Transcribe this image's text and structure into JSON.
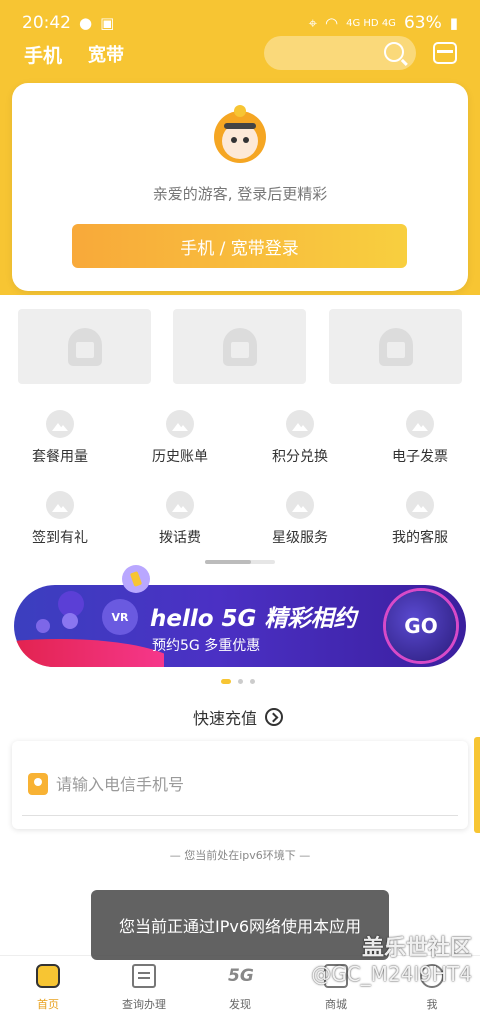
{
  "status_bar": {
    "time": "20:42",
    "battery": "63%",
    "network": "4G HD 4G"
  },
  "nav": {
    "tabs": [
      {
        "label": "手机"
      },
      {
        "label": "宽带"
      }
    ]
  },
  "login_card": {
    "guest_text": "亲爱的游客, 登录后更精彩",
    "login_button": "手机 / 宽带登录"
  },
  "services": [
    {
      "label": "套餐用量"
    },
    {
      "label": "历史账单"
    },
    {
      "label": "积分兑换"
    },
    {
      "label": "电子发票"
    },
    {
      "label": "签到有礼"
    },
    {
      "label": "拨话费"
    },
    {
      "label": "星级服务"
    },
    {
      "label": "我的客服"
    }
  ],
  "promo": {
    "title": "hello 5G 精彩相约",
    "subtitle": "预约5G 多重优惠",
    "badge": "VR",
    "go_label": "GO"
  },
  "carousel": {
    "active_index": 0,
    "count": 3
  },
  "recharge": {
    "title": "快速充值",
    "placeholder": "请输入电信手机号"
  },
  "ipv6_note": "— 您当前处在ipv6环境下 —",
  "toast": "您当前正通过IPv6网络使用本应用",
  "tab_bar": {
    "items": [
      {
        "label": "首页"
      },
      {
        "label": "查询办理"
      },
      {
        "label": "发现",
        "icon_text": "5G"
      },
      {
        "label": "商城"
      },
      {
        "label": "我"
      }
    ]
  },
  "watermark": {
    "line1": "盖乐世社区",
    "line2": "@GC_M24I9HT4"
  },
  "colors": {
    "brand_yellow": "#f7c533",
    "button_orange": "#f8a93a",
    "promo_purple": "#4b30c4"
  }
}
